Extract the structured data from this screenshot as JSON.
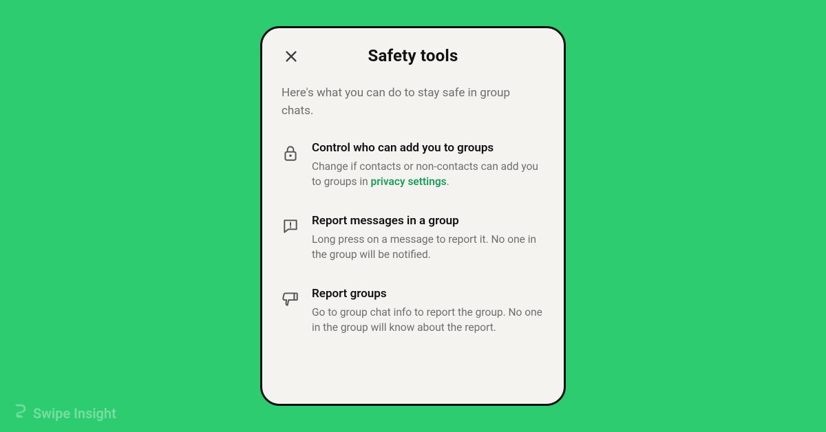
{
  "watermark": "Swipe Insight",
  "card": {
    "title": "Safety tools",
    "intro": "Here's what you can do to stay safe in group chats.",
    "items": [
      {
        "title": "Control who can add you to groups",
        "desc_before": "Change if contacts or non-contacts can add you to groups in ",
        "link_text": "privacy settings",
        "desc_after": "."
      },
      {
        "title": "Report messages in a group",
        "desc": "Long press on a message to report it. No one in the group will be notified."
      },
      {
        "title": "Report groups",
        "desc": "Go to group chat info to report the group. No one in the group will know about the report."
      }
    ]
  }
}
